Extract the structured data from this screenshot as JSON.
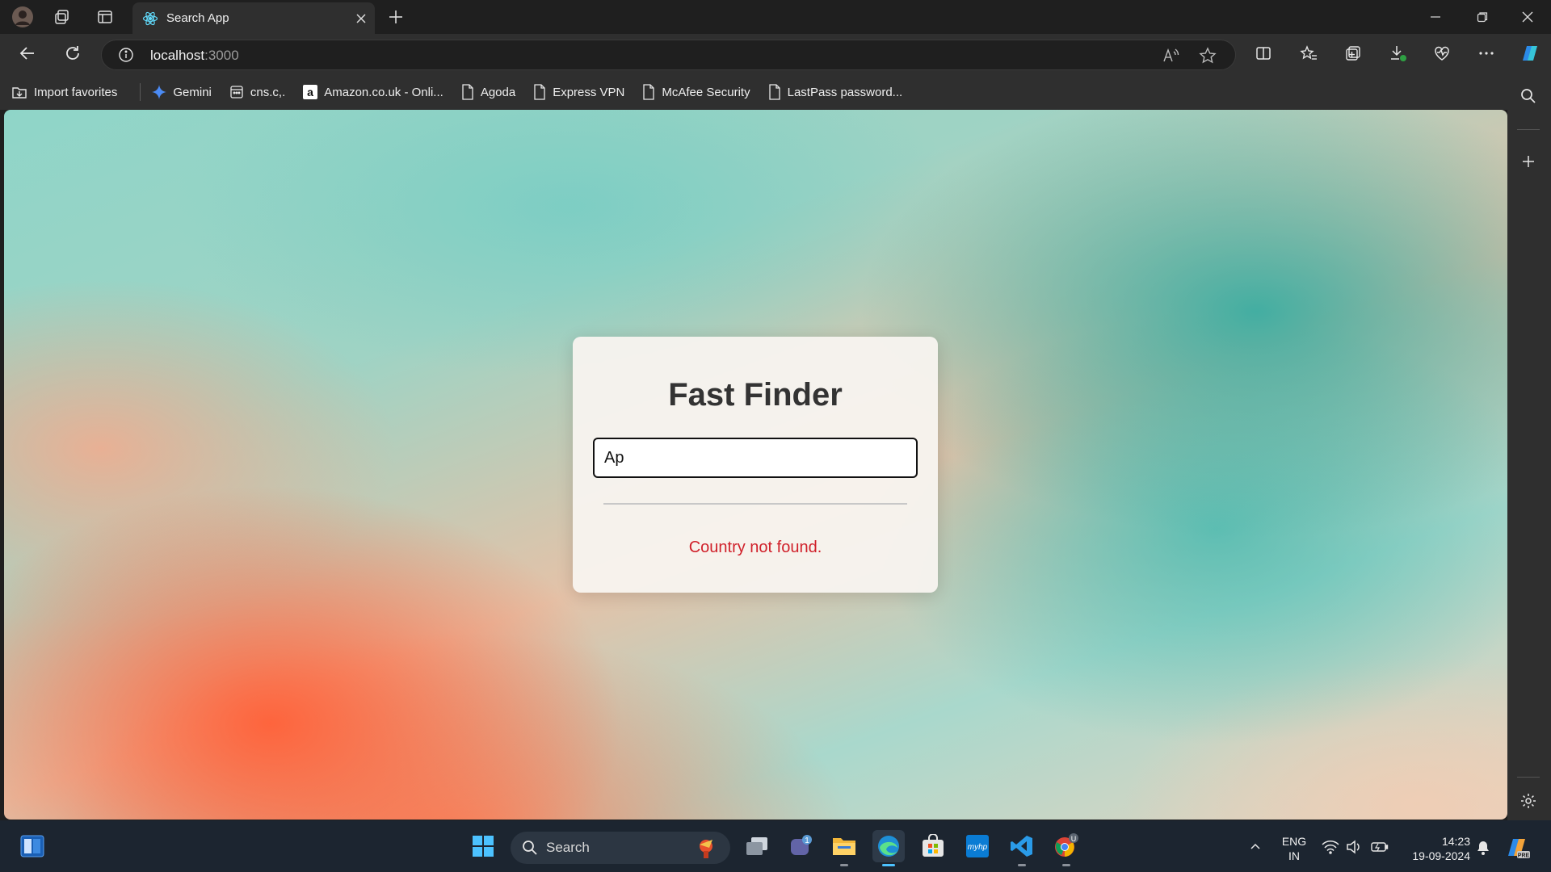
{
  "browser": {
    "tab_title": "Search App",
    "url_host": "localhost",
    "url_port": ":3000",
    "bookmarks": [
      {
        "label": "Import favorites",
        "icon": "import-icon"
      },
      {
        "label": "Gemini",
        "icon": "gemini-icon"
      },
      {
        "label": "cns.c,.",
        "icon": "page-icon"
      },
      {
        "label": "Amazon.co.uk - Onli...",
        "icon": "amazon-icon"
      },
      {
        "label": "Agoda",
        "icon": "document-icon"
      },
      {
        "label": "Express VPN",
        "icon": "document-icon"
      },
      {
        "label": "McAfee Security",
        "icon": "document-icon"
      },
      {
        "label": "LastPass password...",
        "icon": "document-icon"
      }
    ]
  },
  "page": {
    "title": "Fast Finder",
    "search_value": "Ap",
    "error_message": "Country not found.",
    "error_color": "#d0202a"
  },
  "taskbar": {
    "search_placeholder": "Search",
    "lang_top": "ENG",
    "lang_bottom": "IN",
    "time": "14:23",
    "date": "19-09-2024",
    "teams_badge": "1",
    "chrome_badge": "U"
  }
}
